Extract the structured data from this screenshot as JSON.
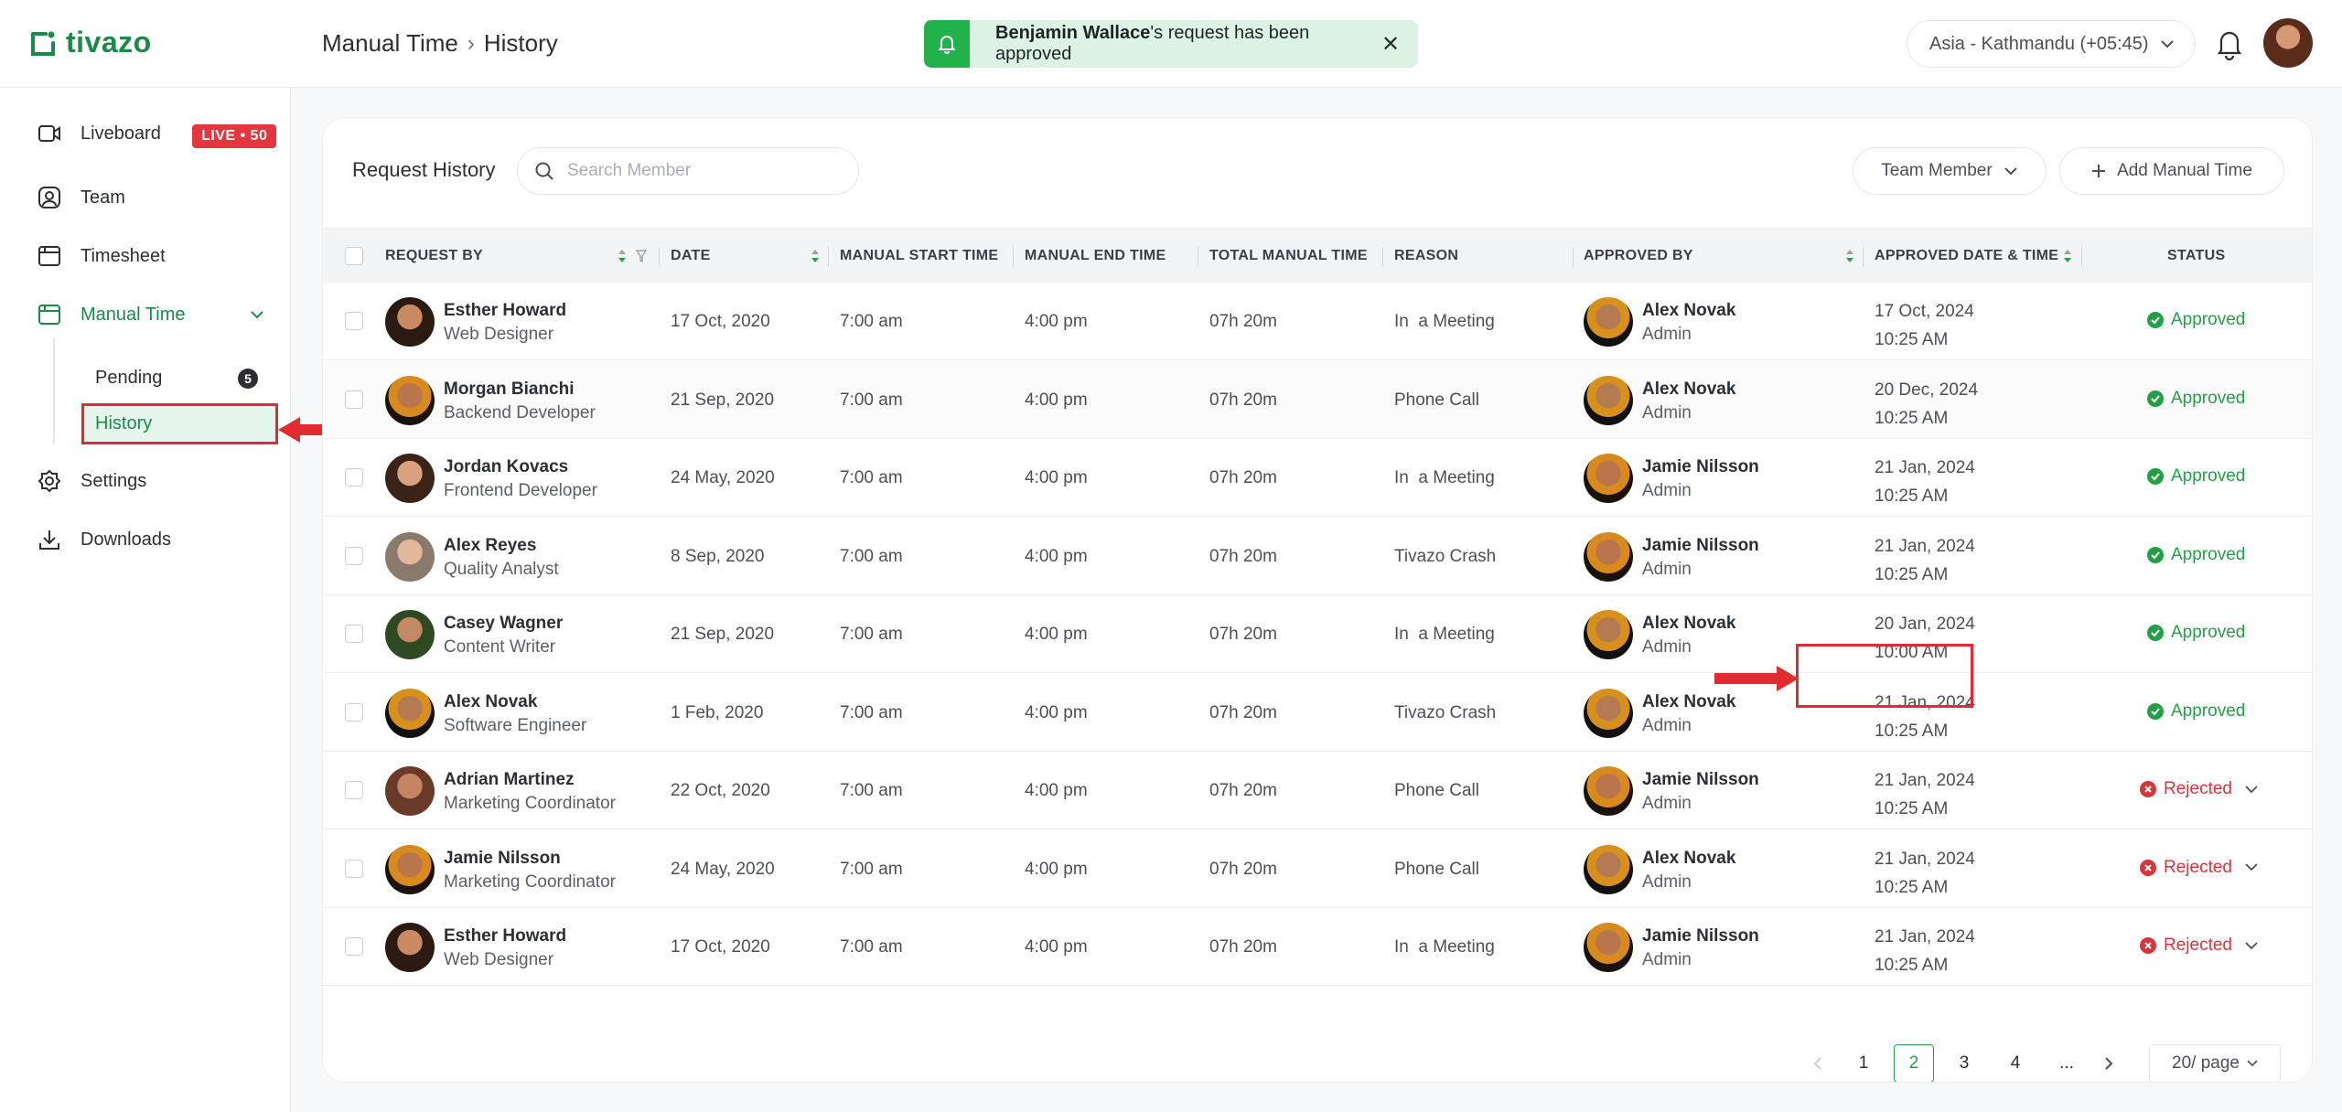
{
  "app": {
    "logo_text": "tivazo"
  },
  "header": {
    "breadcrumb": [
      "Manual Time",
      "History"
    ],
    "toast": {
      "name": "Benjamin Wallace",
      "message": "'s request has been approved"
    },
    "timezone": "Asia - Kathmandu (+05:45)"
  },
  "sidebar": {
    "liveboard": "Liveboard",
    "live_badge": "LIVE • 50",
    "team": "Team",
    "timesheet": "Timesheet",
    "manual_time": "Manual Time",
    "pending": "Pending",
    "pending_count": "5",
    "history": "History",
    "settings": "Settings",
    "downloads": "Downloads"
  },
  "main": {
    "title": "Request History",
    "search_placeholder": "Search Member",
    "team_member_label": "Team Member",
    "add_label": "Add Manual Time",
    "columns": {
      "request_by": "REQUEST BY",
      "date": "DATE",
      "start": "MANUAL START TIME",
      "end": "MANUAL END TIME",
      "total": "TOTAL MANUAL TIME",
      "reason": "REASON",
      "approved_by": "APPROVED BY",
      "approved_dt": "APPROVED DATE & TIME",
      "status": "STATUS"
    },
    "rows": [
      {
        "name": "Esther Howard",
        "role": "Web Designer",
        "date": "17 Oct, 2020",
        "start": "7:00 am",
        "end": "4:00 pm",
        "total": "07h 20m",
        "reason": "In  a Meeting",
        "approver": "Alex Novak",
        "approver_role": "Admin",
        "ap_date": "17 Oct, 2024",
        "ap_time": "10:25 AM",
        "status": "Approved"
      },
      {
        "name": "Morgan Bianchi",
        "role": "Backend Developer",
        "date": "21 Sep, 2020",
        "start": "7:00 am",
        "end": "4:00 pm",
        "total": "07h 20m",
        "reason": "Phone Call",
        "approver": "Alex Novak",
        "approver_role": "Admin",
        "ap_date": "20 Dec, 2024",
        "ap_time": "10:25 AM",
        "status": "Approved"
      },
      {
        "name": "Jordan Kovacs",
        "role": "Frontend Developer",
        "date": "24 May, 2020",
        "start": "7:00 am",
        "end": "4:00 pm",
        "total": "07h 20m",
        "reason": "In  a Meeting",
        "approver": "Jamie Nilsson",
        "approver_role": "Admin",
        "ap_date": "21 Jan, 2024",
        "ap_time": "10:25 AM",
        "status": "Approved"
      },
      {
        "name": "Alex Reyes",
        "role": "Quality Analyst",
        "date": "8 Sep, 2020",
        "start": "7:00 am",
        "end": "4:00 pm",
        "total": "07h 20m",
        "reason": "Tivazo Crash",
        "approver": "Jamie Nilsson",
        "approver_role": "Admin",
        "ap_date": "21 Jan, 2024",
        "ap_time": "10:25 AM",
        "status": "Approved"
      },
      {
        "name": "Casey Wagner",
        "role": "Content Writer",
        "date": "21 Sep, 2020",
        "start": "7:00 am",
        "end": "4:00 pm",
        "total": "07h 20m",
        "reason": "In  a Meeting",
        "approver": "Alex Novak",
        "approver_role": "Admin",
        "ap_date": "20 Jan, 2024",
        "ap_time": "10:00 AM",
        "status": "Approved"
      },
      {
        "name": "Alex Novak",
        "role": "Software Engineer",
        "date": "1 Feb, 2020",
        "start": "7:00 am",
        "end": "4:00 pm",
        "total": "07h 20m",
        "reason": "Tivazo Crash",
        "approver": "Alex Novak",
        "approver_role": "Admin",
        "ap_date": "21 Jan, 2024",
        "ap_time": "10:25 AM",
        "status": "Approved"
      },
      {
        "name": "Adrian Martinez",
        "role": "Marketing Coordinator",
        "date": "22 Oct, 2020",
        "start": "7:00 am",
        "end": "4:00 pm",
        "total": "07h 20m",
        "reason": "Phone Call",
        "approver": "Jamie Nilsson",
        "approver_role": "Admin",
        "ap_date": "21 Jan, 2024",
        "ap_time": "10:25 AM",
        "status": "Rejected"
      },
      {
        "name": "Jamie Nilsson",
        "role": "Marketing Coordinator",
        "date": "24 May, 2020",
        "start": "7:00 am",
        "end": "4:00 pm",
        "total": "07h 20m",
        "reason": "Phone Call",
        "approver": "Alex Novak",
        "approver_role": "Admin",
        "ap_date": "21 Jan, 2024",
        "ap_time": "10:25 AM",
        "status": "Rejected"
      },
      {
        "name": "Esther Howard",
        "role": "Web Designer",
        "date": "17 Oct, 2020",
        "start": "7:00 am",
        "end": "4:00 pm",
        "total": "07h 20m",
        "reason": "In  a Meeting",
        "approver": "Jamie Nilsson",
        "approver_role": "Admin",
        "ap_date": "21 Jan, 2024",
        "ap_time": "10:25 AM",
        "status": "Rejected"
      }
    ],
    "pagination": {
      "pages": [
        "1",
        "2",
        "3",
        "4",
        "..."
      ],
      "current": "2",
      "per_page": "20/ page"
    }
  },
  "colors": {
    "brand": "#1a8a4a",
    "approved": "#23a047",
    "rejected": "#d8343b",
    "live": "#e5363f",
    "highlight": "#e02b31"
  },
  "icons": [
    "liveboard-icon",
    "team-icon",
    "timesheet-icon",
    "manual-time-icon",
    "settings-icon",
    "downloads-icon",
    "bell-icon",
    "search-icon",
    "chevron-down-icon",
    "plus-icon",
    "sort-icon",
    "filter-icon",
    "check-circle-icon",
    "x-circle-icon",
    "close-icon"
  ]
}
